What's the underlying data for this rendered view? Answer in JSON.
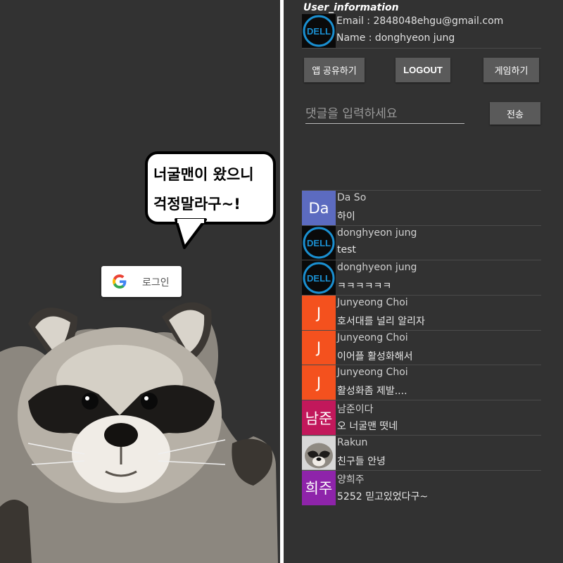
{
  "login_screen": {
    "bubble_line1": "너굴맨이 왔으니",
    "bubble_line2": "걱정말라구~!",
    "google_button_label": "로그인"
  },
  "user_info": {
    "title": "User_information",
    "email_line": "Email : 2848048ehgu@gmail.com",
    "name_line": "Name : donghyeon jung"
  },
  "actions": {
    "share_label": "앱 공유하기",
    "logout_label": "LOGOUT",
    "game_label": "게임하기"
  },
  "comment_box": {
    "placeholder": "댓글을 입력하세요",
    "send_label": "전송"
  },
  "comments": [
    {
      "avatar_text": "Da",
      "avatar_type": "letter",
      "avatar_color": "#5c6bc0",
      "name": "Da So",
      "message": "하이"
    },
    {
      "avatar_text": "",
      "avatar_type": "dell-logo",
      "avatar_color": "#0a0a0a",
      "name": "donghyeon jung",
      "message": "test"
    },
    {
      "avatar_text": "",
      "avatar_type": "dell-logo",
      "avatar_color": "#0a0a0a",
      "name": "donghyeon jung",
      "message": "ㅋㅋㅋㅋㅋㅋ"
    },
    {
      "avatar_text": "J",
      "avatar_type": "letter",
      "avatar_color": "#f4511e",
      "name": "Junyeong Choi",
      "message": "호서대를 널리 알리자"
    },
    {
      "avatar_text": "J",
      "avatar_type": "letter",
      "avatar_color": "#f4511e",
      "name": "Junyeong Choi",
      "message": "이어플 활성화해서"
    },
    {
      "avatar_text": "J",
      "avatar_type": "letter",
      "avatar_color": "#f4511e",
      "name": "Junyeong Choi",
      "message": "활성화좀 제발...."
    },
    {
      "avatar_text": "남준",
      "avatar_type": "letter",
      "avatar_color": "#c2185b",
      "name": "남준이다",
      "message": "오 너굴맨 떳네"
    },
    {
      "avatar_text": "",
      "avatar_type": "raccoon-photo",
      "avatar_color": "#8a8a8a",
      "name": "Rakun",
      "message": "친구들 안녕"
    },
    {
      "avatar_text": "희주",
      "avatar_type": "letter",
      "avatar_color": "#8e24aa",
      "name": "양희주",
      "message": "5252 믿고있었다구~"
    }
  ],
  "colors": {
    "background": "#323232",
    "button": "#5a5a5a",
    "divider": "#4a4a4a"
  },
  "icons": {
    "google": "google-g-icon",
    "user_avatar": "dell-logo-icon"
  }
}
